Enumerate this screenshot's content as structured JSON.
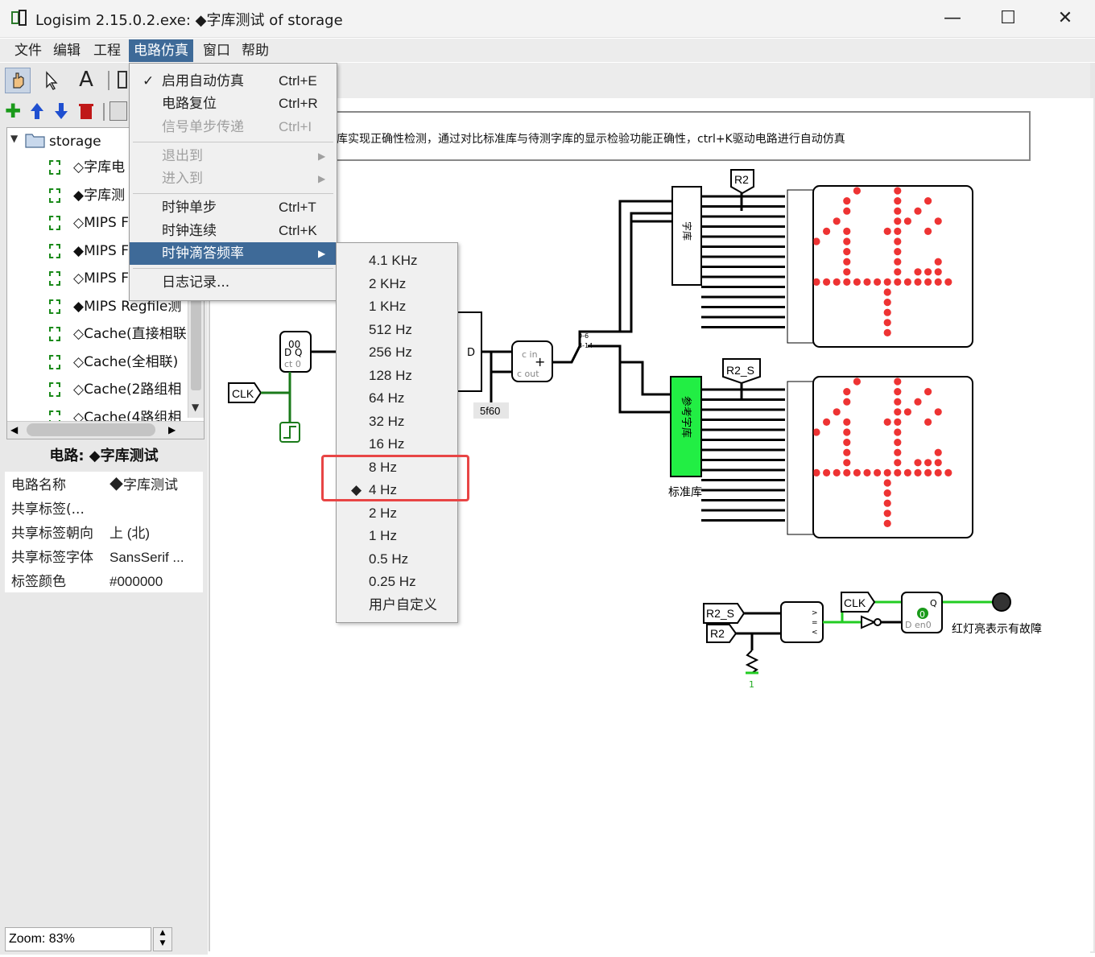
{
  "window": {
    "title": "Logisim 2.15.0.2.exe: ◆字库测试 of storage",
    "minimize": "—",
    "maximize": "☐",
    "close": "✕"
  },
  "menubar": [
    "文件",
    "编辑",
    "工程",
    "电路仿真",
    "窗口",
    "帮助"
  ],
  "sim_menu": {
    "items": [
      {
        "label": "启用自动仿真",
        "shortcut": "Ctrl+E",
        "check": "✓"
      },
      {
        "label": "电路复位",
        "shortcut": "Ctrl+R"
      },
      {
        "label": "信号单步传递",
        "shortcut": "Ctrl+I"
      },
      {
        "label": "退出到",
        "arrow": "▶"
      },
      {
        "label": "进入到",
        "arrow": "▶"
      },
      {
        "label": "时钟单步",
        "shortcut": "Ctrl+T"
      },
      {
        "label": "时钟连续",
        "shortcut": "Ctrl+K"
      },
      {
        "label": "时钟滴答频率",
        "arrow": "▶"
      },
      {
        "label": "日志记录..."
      }
    ]
  },
  "tick_menu": {
    "items": [
      "4.1 KHz",
      "2 KHz",
      "1 KHz",
      "512 Hz",
      "256 Hz",
      "128 Hz",
      "64 Hz",
      "32 Hz",
      "16 Hz",
      "8 Hz",
      "4 Hz",
      "2 Hz",
      "1 Hz",
      "0.5 Hz",
      "0.25 Hz",
      "用户自定义"
    ],
    "selected_marker": "◆"
  },
  "tree": {
    "root": "storage",
    "items": [
      "◇字库电",
      "◆字库测",
      "◇MIPS F",
      "◆MIPS F",
      "◇MIPS F",
      "◆MIPS Regfile测",
      "◇Cache(直接相联",
      "◇Cache(全相联)",
      "◇Cache(2路组相",
      "◇Cache(4路组相"
    ]
  },
  "properties": {
    "header": "电路: ◆字库测试",
    "rows": [
      {
        "key": "电路名称",
        "value": "◆字库测试"
      },
      {
        "key": "共享标签(...",
        "value": ""
      },
      {
        "key": "共享标签朝向",
        "value": "上 (北)"
      },
      {
        "key": "共享标签字体",
        "value": "SansSerif ..."
      },
      {
        "key": "标签颜色",
        "value": "#000000"
      }
    ]
  },
  "zoom": "Zoom: 83%",
  "canvas": {
    "note": "库实现正确性检测，通过对比标准库与待测字库的显示检验功能正确性，ctrl+K驱动电路进行自动仿真",
    "labels": {
      "clk": "CLK",
      "r2": "R2",
      "r2s": "R2_S",
      "zk": "字库",
      "ref": "参考字库",
      "std": "标准库",
      "const": "5f60",
      "reg_val": "00",
      "lamp": "红灯亮表示有故障",
      "one": "1",
      "d": "D",
      "q": "Q",
      "cin": "c in",
      "cout": "c out",
      "ct": "ct 0",
      "dq": "D Q",
      "en0": "D en0",
      "zero": "0",
      "split1": "0-6",
      "split2": "8-14"
    }
  },
  "colors": {
    "accent": "#3e6a98",
    "wire_on": "#00c000",
    "wire_dark": "#006400",
    "led": "#ee3333",
    "highlight": "#e84545"
  }
}
